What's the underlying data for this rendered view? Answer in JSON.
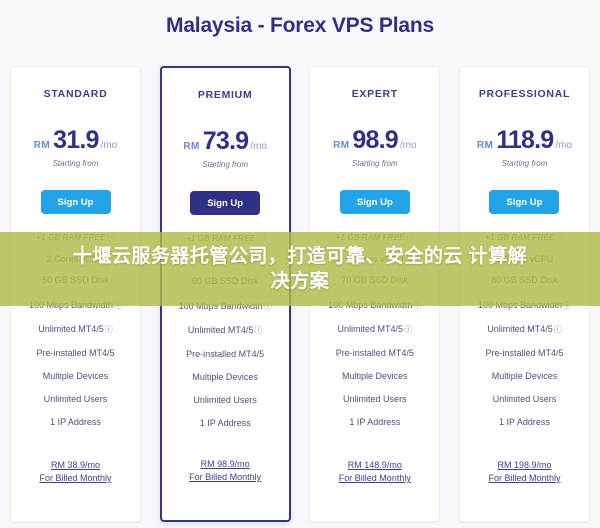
{
  "page": {
    "title": "Malaysia - Forex VPS Plans",
    "background_color": "#f7f8fb",
    "accent_navy": "#2f3284",
    "accent_blue": "#23a3e8",
    "overlay_color": "#b0bc48"
  },
  "overlay": {
    "line1": "十堰云服务器托管公司，打造可靠、安全的云",
    "line2": "计算解决方案"
  },
  "labels": {
    "starting_from": "Starting from",
    "sign_up": "Sign Up",
    "currency": "RM",
    "per_month": "/mo",
    "billed_monthly": "For Billed Monthly",
    "info_icon": "ⓘ"
  },
  "plans": [
    {
      "name": "STANDARD",
      "currency": "RM",
      "price": "31.9",
      "per": "/mo",
      "starting_from": "Starting from",
      "button_label": "Sign Up",
      "button_style": "blue",
      "featured": false,
      "ram": "+1 GB RAM FREE",
      "cpu": "2 Cores vCPU",
      "disk": "50 GB SSD Disk",
      "features": [
        {
          "text": "100 Mbps Bandwidth",
          "info": true
        },
        {
          "text": "Unlimited MT4/5",
          "info": true
        },
        {
          "text": "Pre-installed MT4/5",
          "info": false
        },
        {
          "text": "Multiple Devices",
          "info": false
        },
        {
          "text": "Unlimited Users",
          "info": false
        },
        {
          "text": "1 IP Address",
          "info": false
        }
      ],
      "footer_price": "RM 38.9/mo",
      "footer_note": "For Billed Monthly"
    },
    {
      "name": "PREMIUM",
      "currency": "RM",
      "price": "73.9",
      "per": "/mo",
      "starting_from": "Starting from",
      "button_label": "Sign Up",
      "button_style": "navy",
      "featured": true,
      "ram": "+1 GB RAM FREE",
      "cpu": "4 Cores vCPU",
      "disk": "60 GB SSD Disk",
      "features": [
        {
          "text": "100 Mbps Bandwidth",
          "info": true
        },
        {
          "text": "Unlimited MT4/5",
          "info": true
        },
        {
          "text": "Pre-installed MT4/5",
          "info": false
        },
        {
          "text": "Multiple Devices",
          "info": false
        },
        {
          "text": "Unlimited Users",
          "info": false
        },
        {
          "text": "1 IP Address",
          "info": false
        }
      ],
      "footer_price": "RM 98.9/mo",
      "footer_note": "For Billed Monthly"
    },
    {
      "name": "EXPERT",
      "currency": "RM",
      "price": "98.9",
      "per": "/mo",
      "starting_from": "Starting from",
      "button_label": "Sign Up",
      "button_style": "blue",
      "featured": false,
      "ram": "+1 GB RAM FREE",
      "cpu": "6 Cores vCPU",
      "disk": "70 GB SSD Disk",
      "features": [
        {
          "text": "100 Mbps Bandwidth",
          "info": true
        },
        {
          "text": "Unlimited MT4/5",
          "info": true
        },
        {
          "text": "Pre-installed MT4/5",
          "info": false
        },
        {
          "text": "Multiple Devices",
          "info": false
        },
        {
          "text": "Unlimited Users",
          "info": false
        },
        {
          "text": "1 IP Address",
          "info": false
        }
      ],
      "footer_price": "RM 148.9/mo",
      "footer_note": "For Billed Monthly"
    },
    {
      "name": "PROFESSIONAL",
      "currency": "RM",
      "price": "118.9",
      "per": "/mo",
      "starting_from": "Starting from",
      "button_label": "Sign Up",
      "button_style": "blue",
      "featured": false,
      "ram": "+1 GB RAM FREE",
      "cpu": "8 Cores vCPU",
      "disk": "80 GB SSD Disk",
      "features": [
        {
          "text": "100 Mbps Bandwidth",
          "info": true
        },
        {
          "text": "Unlimited MT4/5",
          "info": true
        },
        {
          "text": "Pre-installed MT4/5",
          "info": false
        },
        {
          "text": "Multiple Devices",
          "info": false
        },
        {
          "text": "Unlimited Users",
          "info": false
        },
        {
          "text": "1 IP Address",
          "info": false
        }
      ],
      "footer_price": "RM 198.9/mo",
      "footer_note": "For Billed Monthly"
    }
  ]
}
